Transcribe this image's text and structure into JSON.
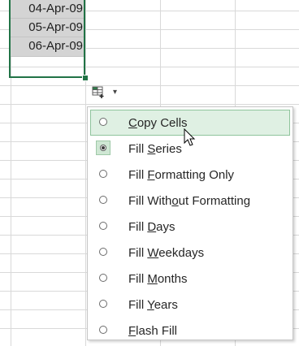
{
  "cells": [
    {
      "value": "04-Apr-09"
    },
    {
      "value": "05-Apr-09"
    },
    {
      "value": "06-Apr-09"
    }
  ],
  "autofill": {
    "icon": "autofill-options-icon",
    "caret": "▾"
  },
  "menu": {
    "items": [
      {
        "pre": "",
        "key": "C",
        "post": "opy Cells",
        "selected": false,
        "hover": true
      },
      {
        "pre": "Fill ",
        "key": "S",
        "post": "eries",
        "selected": true,
        "hover": false
      },
      {
        "pre": "Fill ",
        "key": "F",
        "post": "ormatting Only",
        "selected": false,
        "hover": false
      },
      {
        "pre": "Fill With",
        "key": "o",
        "post": "ut Formatting",
        "selected": false,
        "hover": false
      },
      {
        "pre": "Fill ",
        "key": "D",
        "post": "ays",
        "selected": false,
        "hover": false
      },
      {
        "pre": "Fill ",
        "key": "W",
        "post": "eekdays",
        "selected": false,
        "hover": false
      },
      {
        "pre": "Fill ",
        "key": "M",
        "post": "onths",
        "selected": false,
        "hover": false
      },
      {
        "pre": "Fill ",
        "key": "Y",
        "post": "ears",
        "selected": false,
        "hover": false
      },
      {
        "pre": "",
        "key": "F",
        "post": "lash Fill",
        "selected": false,
        "hover": false
      }
    ]
  },
  "colors": {
    "selection_border": "#217346",
    "hover_bg": "#dff0e3",
    "hover_border": "#8fc49c"
  }
}
